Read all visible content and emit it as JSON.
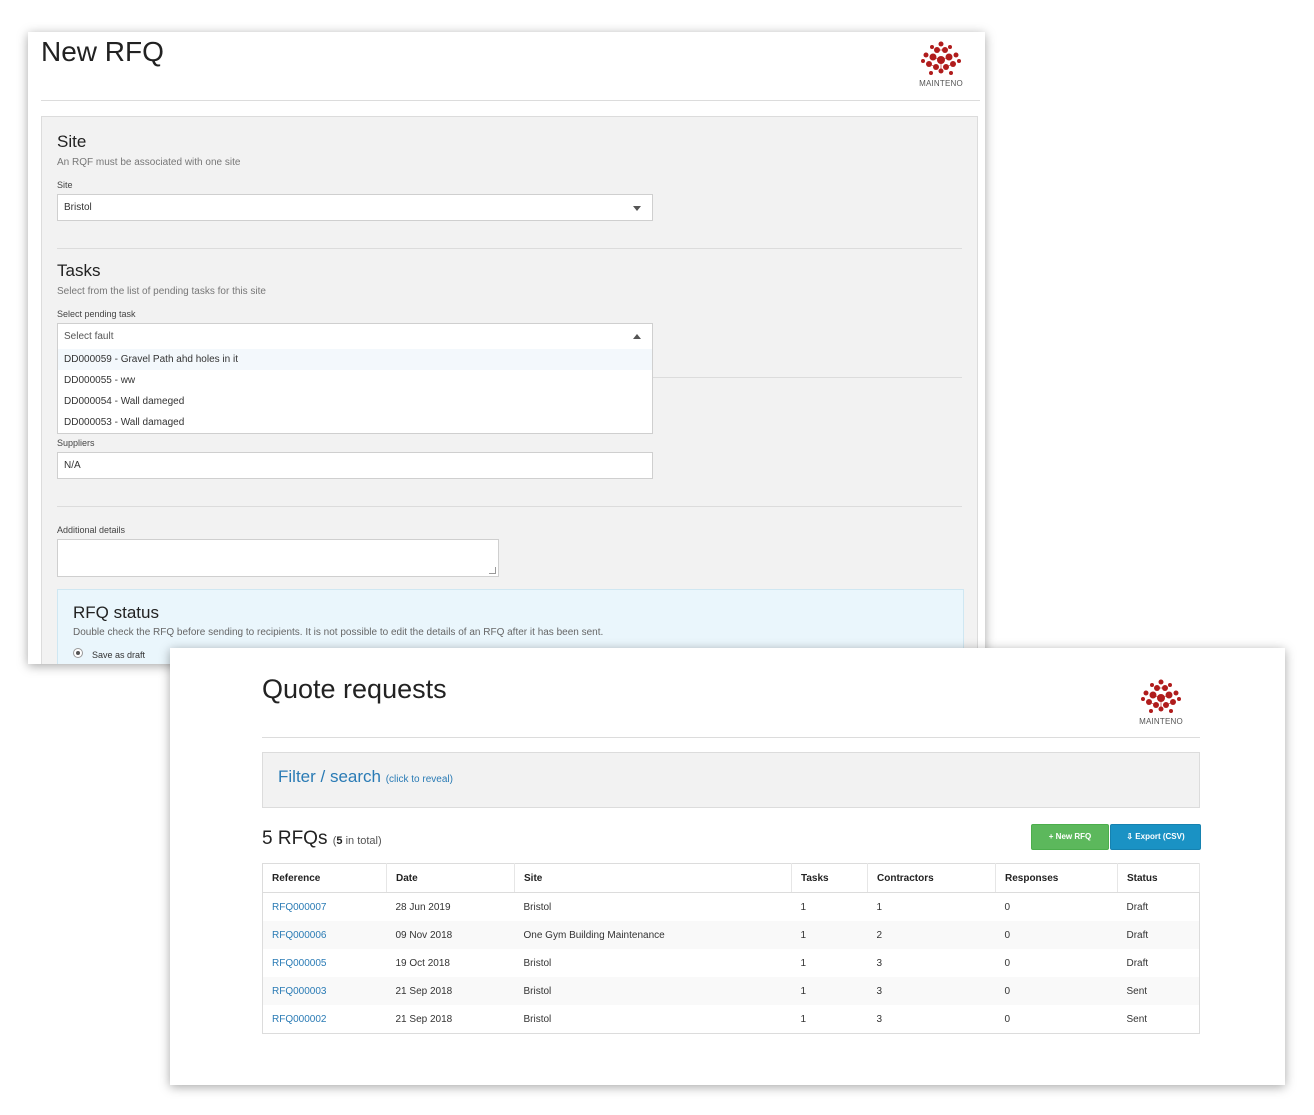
{
  "new_rfq": {
    "title": "New RFQ",
    "logo_text": "MAINTENO",
    "site_section": {
      "title": "Site",
      "help": "An RQF must be associated with one site",
      "field_label": "Site",
      "selected": "Bristol"
    },
    "tasks_section": {
      "title": "Tasks",
      "help": "Select from the list of pending tasks for this site",
      "field_label": "Select pending task",
      "placeholder": "Select fault",
      "options": [
        "DD000059 - Gravel Path ahd holes in it",
        "DD000055 - ww",
        "DD000054 - Wall dameged",
        "DD000053 - Wall damaged"
      ]
    },
    "suppliers": {
      "label": "Suppliers",
      "value": "N/A"
    },
    "additional_details": {
      "label": "Additional details",
      "value": ""
    },
    "rfq_status": {
      "title": "RFQ status",
      "help": "Double check the RFQ before sending to recipients. It is not possible to edit the details of an RFQ after it has been sent.",
      "option_label": "Save as draft"
    }
  },
  "quote_requests": {
    "title": "Quote requests",
    "logo_text": "MAINTENO",
    "filter": {
      "title": "Filter / search",
      "hint": "(click to reveal)"
    },
    "count": {
      "main": "5 RFQs",
      "open": "(",
      "total": "5",
      "rest": " in total)"
    },
    "buttons": {
      "new_rfq": "+ New RFQ",
      "export": "⇩ Export (CSV)"
    },
    "columns": [
      "Reference",
      "Date",
      "Site",
      "Tasks",
      "Contractors",
      "Responses",
      "Status"
    ],
    "rows": [
      {
        "reference": "RFQ000007",
        "date": "28 Jun 2019",
        "site": "Bristol",
        "tasks": "1",
        "contractors": "1",
        "responses": "0",
        "status": "Draft"
      },
      {
        "reference": "RFQ000006",
        "date": "09 Nov 2018",
        "site": "One Gym Building Maintenance",
        "tasks": "1",
        "contractors": "2",
        "responses": "0",
        "status": "Draft"
      },
      {
        "reference": "RFQ000005",
        "date": "19 Oct 2018",
        "site": "Bristol",
        "tasks": "1",
        "contractors": "3",
        "responses": "0",
        "status": "Draft"
      },
      {
        "reference": "RFQ000003",
        "date": "21 Sep 2018",
        "site": "Bristol",
        "tasks": "1",
        "contractors": "3",
        "responses": "0",
        "status": "Sent"
      },
      {
        "reference": "RFQ000002",
        "date": "21 Sep 2018",
        "site": "Bristol",
        "tasks": "1",
        "contractors": "3",
        "responses": "0",
        "status": "Sent"
      }
    ]
  },
  "colors": {
    "link": "#2a7bb5",
    "new_button": "#5cb85c",
    "export_button": "#1a92c4",
    "logo": "#b01c1c",
    "status_panel": "#eaf6fc"
  },
  "icons": {
    "logo": "mainteno-logo-icon",
    "dropdown": "chevron-down-icon",
    "dropdown_open": "chevron-up-icon"
  }
}
